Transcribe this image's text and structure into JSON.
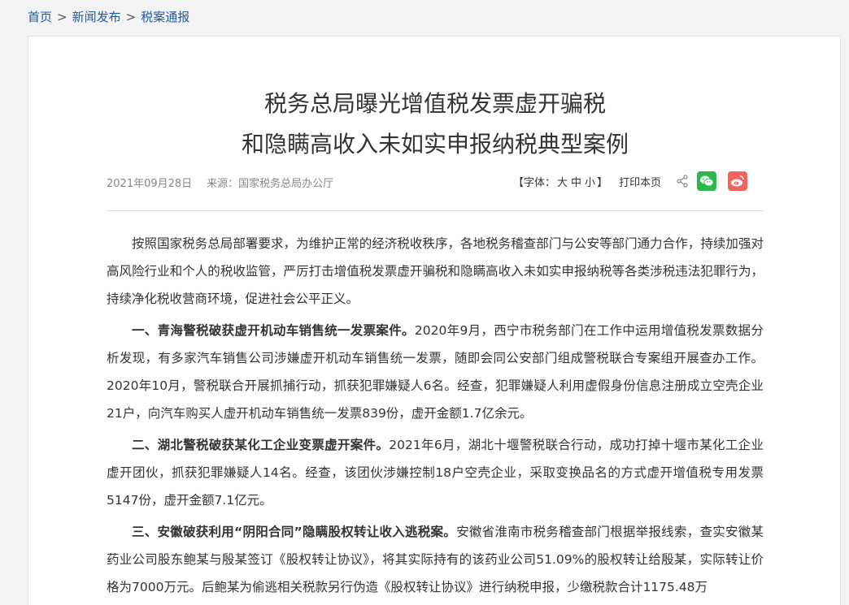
{
  "breadcrumb": {
    "home": "首页",
    "sep1": ">",
    "news": "新闻发布",
    "sep2": ">",
    "current": "税案通报"
  },
  "article": {
    "title_line1": "税务总局曝光增值税发票虚开骗税",
    "title_line2": "和隐瞒高收入未如实申报纳税典型案例",
    "date": "2021年09月28日",
    "source": "来源：国家税务总局办公厅"
  },
  "tools": {
    "font_label_open": "【字体：",
    "font_large": "大",
    "font_medium": "中",
    "font_small": "小",
    "font_label_close": "】",
    "print": "打印本页",
    "icons": [
      "share-icon",
      "wechat-icon",
      "weibo-icon"
    ],
    "colors": {
      "wechat": "#2db84d",
      "weibo": "#f0655c",
      "link": "#1e5aa8"
    }
  },
  "paragraphs": [
    {
      "bold": "",
      "text": "按照国家税务总局部署要求，为维护正常的经济税收秩序，各地税务稽查部门与公安等部门通力合作，持续加强对高风险行业和个人的税收监管，严厉打击增值税发票虚开骗税和隐瞒高收入未如实申报纳税等各类涉税违法犯罪行为，持续净化税收营商环境，促进社会公平正义。"
    },
    {
      "bold": "一、青海警税破获虚开机动车销售统一发票案件。",
      "text": "2020年9月，西宁市税务部门在工作中运用增值税发票数据分析发现，有多家汽车销售公司涉嫌虚开机动车销售统一发票，随即会同公安部门组成警税联合专案组开展查办工作。2020年10月，警税联合开展抓捕行动，抓获犯罪嫌疑人6名。经查，犯罪嫌疑人利用虚假身份信息注册成立空壳企业21户，向汽车购买人虚开机动车销售统一发票839份，虚开金额1.7亿余元。"
    },
    {
      "bold": "二、湖北警税破获某化工企业变票虚开案件。",
      "text": "2021年6月，湖北十堰警税联合行动，成功打掉十堰市某化工企业虚开团伙，抓获犯罪嫌疑人14名。经查，该团伙涉嫌控制18户空壳企业，采取变换品名的方式虚开增值税专用发票5147份，虚开金额7.1亿元。"
    },
    {
      "bold": "三、安徽破获利用“阴阳合同”隐瞒股权转让收入逃税案。",
      "text": "安徽省淮南市税务稽查部门根据举报线索，查实安徽某药业公司股东鲍某与殷某签订《股权转让协议》，将其实际持有的该药业公司51.09%的股权转让给殷某，实际转让价格为7000万元。后鲍某为偷逃相关税款另行伪造《股权转让协议》进行纳税申报，少缴税款合计1175.48万"
    }
  ]
}
